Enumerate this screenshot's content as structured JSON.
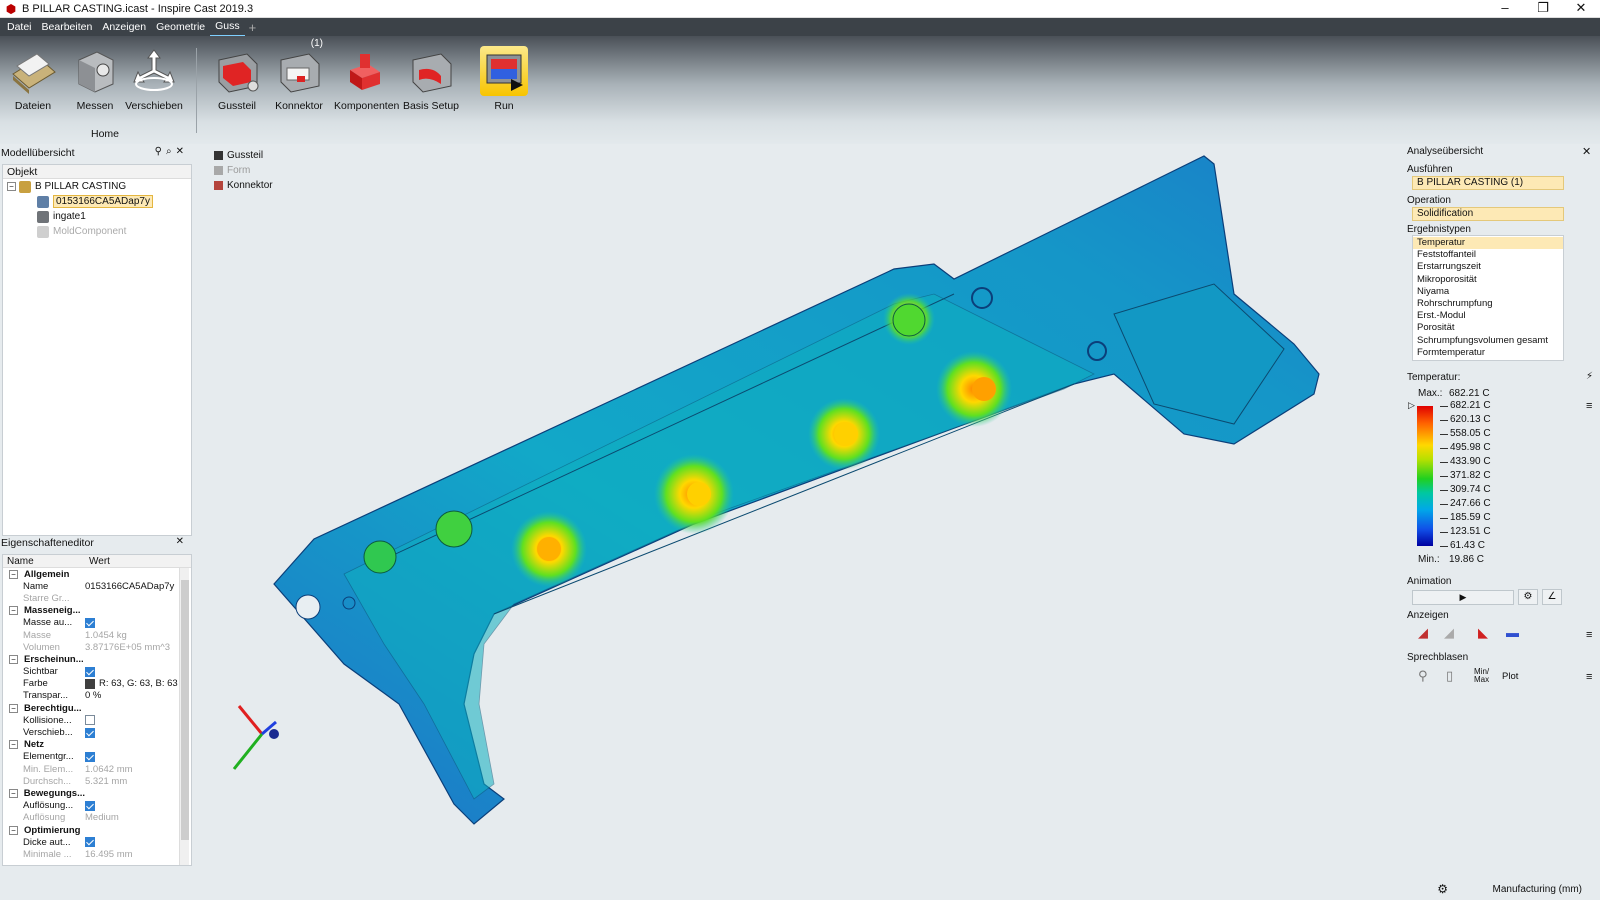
{
  "window": {
    "title": "B PILLAR CASTING.icast - Inspire Cast 2019.3"
  },
  "menu": [
    {
      "label": "Datei"
    },
    {
      "label": "Bearbeiten"
    },
    {
      "label": "Anzeigen"
    },
    {
      "label": "Geometrie"
    },
    {
      "label": "Guss"
    }
  ],
  "ribbon": {
    "buttons": [
      {
        "label": "Dateien",
        "icon": "files-icon"
      },
      {
        "label": "Messen",
        "icon": "measure-icon"
      },
      {
        "label": "Verschieben",
        "icon": "move-icon"
      },
      {
        "label": "Gussteil",
        "icon": "casting-part-icon"
      },
      {
        "label": "Konnektor",
        "icon": "connector-icon",
        "badge": "(1)"
      },
      {
        "label": "Komponenten",
        "icon": "components-icon"
      },
      {
        "label": "Basis Setup",
        "icon": "basic-setup-icon"
      },
      {
        "label": "Run",
        "icon": "run-icon"
      }
    ],
    "home_group": "Home"
  },
  "model_browser": {
    "title": "Modellübersicht",
    "column": "Objekt",
    "nodes": [
      {
        "label": "B PILLAR CASTING"
      },
      {
        "label": "0153166CA5ADap7y"
      },
      {
        "label": "ingate1"
      },
      {
        "label": "MoldComponent"
      }
    ]
  },
  "property_editor": {
    "title": "Eigenschafteneditor",
    "col_name": "Name",
    "col_value": "Wert",
    "groups": [
      {
        "label": "Allgemein",
        "rows": [
          {
            "name": "Name",
            "value": "0153166CA5ADap7y"
          },
          {
            "name": "Starre Gr...",
            "value": ""
          }
        ]
      },
      {
        "label": "Masseneig...",
        "rows": [
          {
            "name": "Masse au...",
            "value": ""
          },
          {
            "name": "Masse",
            "value": "1.0454 kg"
          },
          {
            "name": "Volumen",
            "value": "3.87176E+05 mm^3"
          }
        ]
      },
      {
        "label": "Erscheinun...",
        "rows": [
          {
            "name": "Sichtbar",
            "value": ""
          },
          {
            "name": "Farbe",
            "value": "R: 63, G: 63, B: 63"
          },
          {
            "name": "Transpar...",
            "value": "0 %"
          }
        ]
      },
      {
        "label": "Berechtigu...",
        "rows": [
          {
            "name": "Kollisione...",
            "value": ""
          },
          {
            "name": "Verschieb...",
            "value": ""
          }
        ]
      },
      {
        "label": "Netz",
        "rows": [
          {
            "name": "Elementgr...",
            "value": ""
          },
          {
            "name": "Min. Elem...",
            "value": "1.0642 mm"
          },
          {
            "name": "Durchsch...",
            "value": "5.321 mm"
          }
        ]
      },
      {
        "label": "Bewegungs...",
        "rows": [
          {
            "name": "Auflösung...",
            "value": ""
          },
          {
            "name": "Auflösung",
            "value": "Medium"
          }
        ]
      },
      {
        "label": "Optimierung",
        "rows": [
          {
            "name": "Dicke aut...",
            "value": ""
          },
          {
            "name": "Minimale ...",
            "value": "16.495 mm"
          }
        ]
      }
    ]
  },
  "viewport_legend": [
    {
      "label": "Gussteil",
      "color": "#333333"
    },
    {
      "label": "Form",
      "color": "#a8a8a8"
    },
    {
      "label": "Konnektor",
      "color": "#b4443c"
    }
  ],
  "analysis": {
    "title": "Analyseübersicht",
    "run_label": "Ausführen",
    "run_value": "B PILLAR CASTING (1)",
    "operation_label": "Operation",
    "operation_value": "Solidification",
    "result_types_label": "Ergebnistypen",
    "result_types": [
      "Temperatur",
      "Feststoffanteil",
      "Erstarrungszeit",
      "Mikroporosität",
      "Niyama",
      "Rohrschrumpfung",
      "Erst.-Modul",
      "Porosität",
      "Schrumpfungsvolumen gesamt",
      "Formtemperatur"
    ],
    "temperature_label": "Temperatur:",
    "max_label": "Max.:",
    "max_value": "682.21 C",
    "min_label": "Min.:",
    "min_value": "19.86 C",
    "scale": [
      "682.21 C",
      "620.13 C",
      "558.05 C",
      "495.98 C",
      "433.90 C",
      "371.82 C",
      "309.74 C",
      "247.66 C",
      "185.59 C",
      "123.51 C",
      "61.43 C"
    ],
    "animation_label": "Animation",
    "display_label": "Anzeigen",
    "callouts_label": "Sprechblasen",
    "minmax_label": "Min/ Max",
    "plot_label": "Plot"
  },
  "status": {
    "units": "Manufacturing (mm)"
  }
}
